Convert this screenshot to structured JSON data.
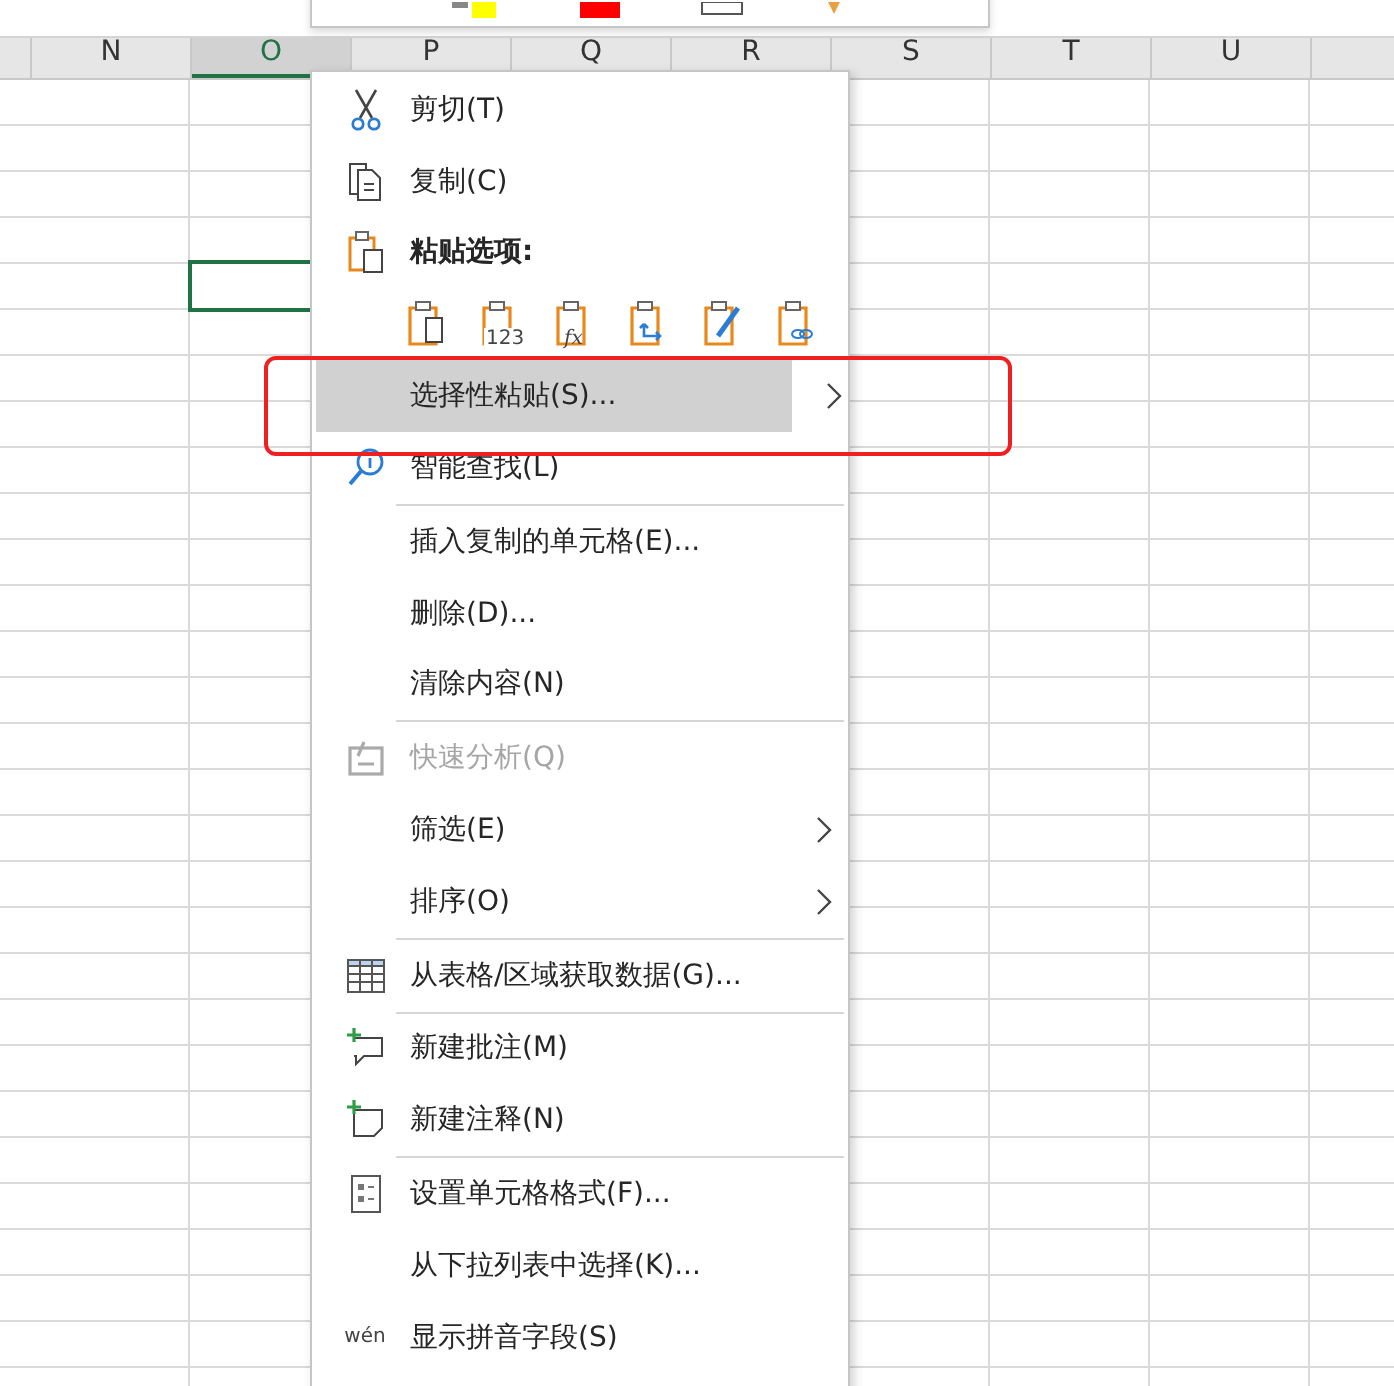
{
  "columns": [
    {
      "label": "N",
      "selected": false
    },
    {
      "label": "O",
      "selected": true
    },
    {
      "label": "P",
      "selected": false
    },
    {
      "label": "Q",
      "selected": false
    },
    {
      "label": "R",
      "selected": false
    },
    {
      "label": "S",
      "selected": false
    },
    {
      "label": "T",
      "selected": false
    },
    {
      "label": "U",
      "selected": false
    }
  ],
  "context_menu": {
    "items": [
      {
        "kind": "command",
        "label": "剪切(T)",
        "divider_before": false,
        "highlighted": false,
        "disabled": false,
        "submenu": false
      },
      {
        "kind": "command",
        "label": "复制(C)",
        "divider_before": false,
        "highlighted": false,
        "disabled": false,
        "submenu": false
      },
      {
        "kind": "heading",
        "label": "粘贴选项:",
        "divider_before": false,
        "highlighted": false,
        "disabled": false,
        "submenu": false
      },
      {
        "kind": "paste_options",
        "buttons": [
          {
            "kind": "plain"
          },
          {
            "kind": "values",
            "caption": "123"
          },
          {
            "kind": "formula",
            "caption": "fx"
          },
          {
            "kind": "transpose"
          },
          {
            "kind": "formatting"
          },
          {
            "kind": "link"
          }
        ]
      },
      {
        "kind": "command",
        "label": "选择性粘贴(S)...",
        "divider_before": false,
        "highlighted": true,
        "disabled": false,
        "submenu": true
      },
      {
        "kind": "command",
        "label": "智能查找(L)",
        "divider_before": false,
        "highlighted": false,
        "disabled": false,
        "submenu": false
      },
      {
        "kind": "command",
        "label": "插入复制的单元格(E)...",
        "divider_before": true,
        "highlighted": false,
        "disabled": false,
        "submenu": false
      },
      {
        "kind": "command",
        "label": "删除(D)...",
        "divider_before": false,
        "highlighted": false,
        "disabled": false,
        "submenu": false
      },
      {
        "kind": "command",
        "label": "清除内容(N)",
        "divider_before": false,
        "highlighted": false,
        "disabled": false,
        "submenu": false
      },
      {
        "kind": "command",
        "label": "快速分析(Q)",
        "divider_before": true,
        "highlighted": false,
        "disabled": true,
        "submenu": false
      },
      {
        "kind": "command",
        "label": "筛选(E)",
        "divider_before": false,
        "highlighted": false,
        "disabled": false,
        "submenu": true
      },
      {
        "kind": "command",
        "label": "排序(O)",
        "divider_before": false,
        "highlighted": false,
        "disabled": false,
        "submenu": true
      },
      {
        "kind": "command",
        "label": "从表格/区域获取数据(G)...",
        "divider_before": true,
        "highlighted": false,
        "disabled": false,
        "submenu": false
      },
      {
        "kind": "command",
        "label": "新建批注(M)",
        "divider_before": true,
        "highlighted": false,
        "disabled": false,
        "submenu": false
      },
      {
        "kind": "command",
        "label": "新建注释(N)",
        "divider_before": false,
        "highlighted": false,
        "disabled": false,
        "submenu": false
      },
      {
        "kind": "command",
        "label": "设置单元格格式(F)...",
        "divider_before": true,
        "highlighted": false,
        "disabled": false,
        "submenu": false
      },
      {
        "kind": "command",
        "label": "从下拉列表中选择(K)...",
        "divider_before": false,
        "highlighted": false,
        "disabled": false,
        "submenu": false
      },
      {
        "kind": "command",
        "label": "显示拼音字段(S)",
        "icon_text": "wén",
        "divider_before": false,
        "highlighted": false,
        "disabled": false,
        "submenu": false
      }
    ]
  }
}
